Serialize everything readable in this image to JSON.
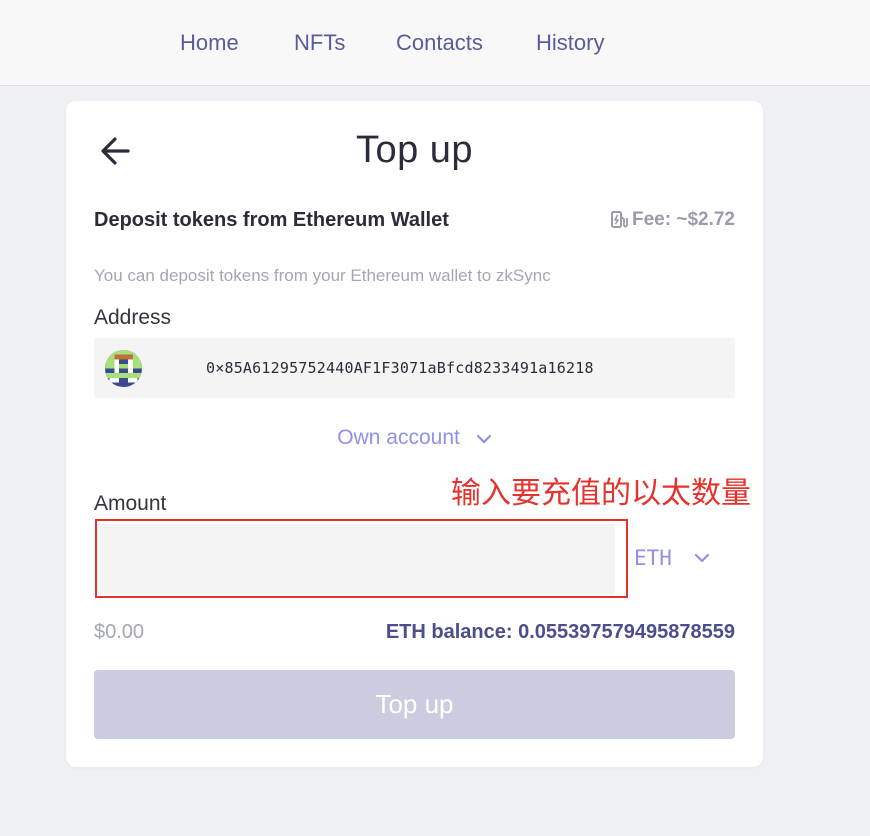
{
  "nav": {
    "home": "Home",
    "nfts": "NFTs",
    "contacts": "Contacts",
    "history": "History"
  },
  "page": {
    "title": "Top up",
    "section_title": "Deposit tokens from Ethereum Wallet",
    "fee": "Fee: ~$2.72",
    "description": "You can deposit tokens from your Ethereum wallet to zkSync"
  },
  "address": {
    "label": "Address",
    "value": "0×85A61295752440AF1F3071aBfcd8233491a16218",
    "account_option": "Own account"
  },
  "amount": {
    "label": "Amount",
    "value": "",
    "token": "ETH",
    "usd_value": "$0.00",
    "balance": "ETH balance: 0.055397579495878559"
  },
  "annotation": "输入要充值的以太数量",
  "submit_label": "Top up",
  "colors": {
    "accent": "#8f91e6",
    "nav_text": "#5a5c9a",
    "button_disabled": "#cccce0",
    "annotation_red": "#e5322d"
  },
  "icons": {
    "back": "arrow-left-icon",
    "fee": "gas-pump-icon",
    "dropdown": "chevron-down-icon"
  }
}
